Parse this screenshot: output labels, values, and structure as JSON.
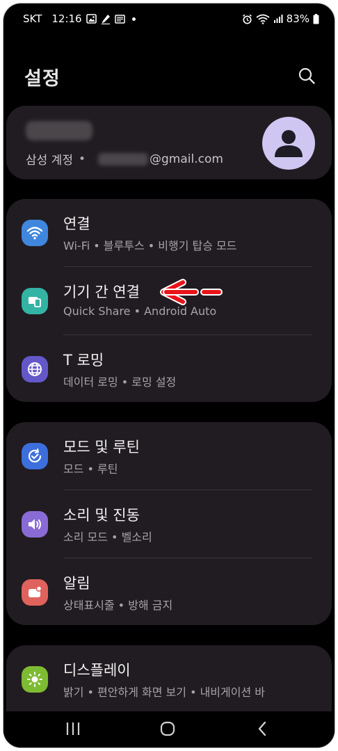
{
  "status_bar": {
    "carrier": "SKT",
    "time": "12:16",
    "battery": "83%"
  },
  "header": {
    "title": "설정"
  },
  "account": {
    "label": "삼성 계정",
    "email_suffix": "@gmail.com"
  },
  "groups": [
    {
      "items": [
        {
          "label": "연결",
          "sub": "Wi-Fi • 블루투스 • 비행기 탑승 모드",
          "icon": "wifi-icon",
          "color": "#3f86dd"
        },
        {
          "label": "기기 간 연결",
          "sub": "Quick Share • Android Auto",
          "icon": "device-connect-icon",
          "color": "#32b3a4"
        },
        {
          "label": "T 로밍",
          "sub": "데이터 로밍 • 로밍 설정",
          "icon": "globe-icon",
          "color": "#6458c9"
        }
      ]
    },
    {
      "items": [
        {
          "label": "모드 및 루틴",
          "sub": "모드 • 루틴",
          "icon": "routine-check-icon",
          "color": "#3d6fdc"
        },
        {
          "label": "소리 및 진동",
          "sub": "소리 모드 • 벨소리",
          "icon": "speaker-icon",
          "color": "#8a6bd6"
        },
        {
          "label": "알림",
          "sub": "상태표시줄 • 방해 금지",
          "icon": "notification-icon",
          "color": "#e0625c"
        }
      ]
    },
    {
      "items": [
        {
          "label": "디스플레이",
          "sub": "밝기 • 편안하게 화면 보기 • 내비게이션 바",
          "icon": "brightness-icon",
          "color": "#7dbb32"
        }
      ]
    }
  ],
  "annotation": {
    "arrow_color": "#e8141a"
  }
}
